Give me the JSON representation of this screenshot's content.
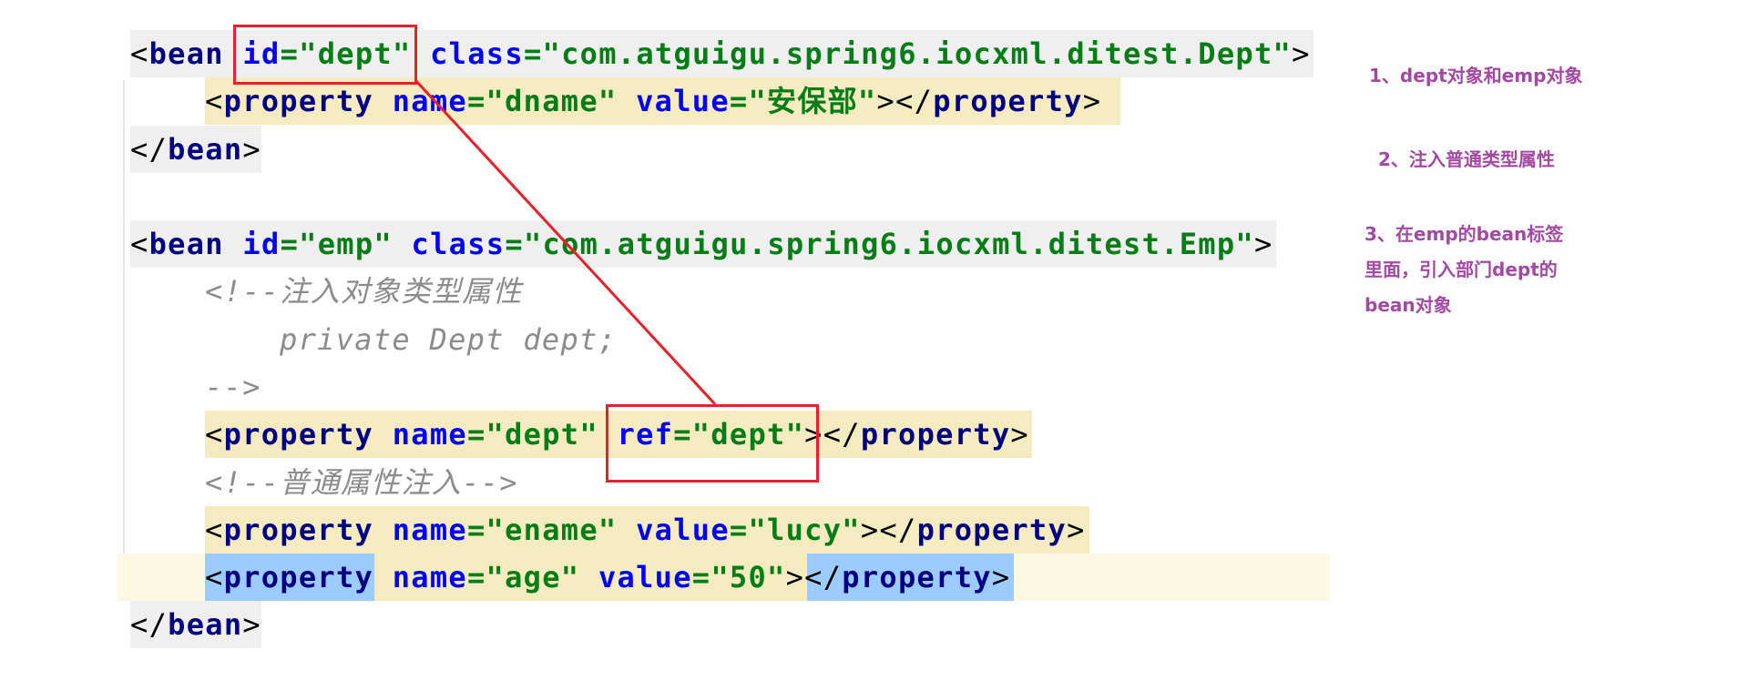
{
  "code": {
    "lines": [
      {
        "parts": [
          "<",
          "bean",
          " ",
          "id",
          "=\"dept\"",
          " ",
          "class",
          "=\"com.atguigu.spring6.iocxml.ditest.Dept\"",
          ">"
        ]
      },
      {
        "parts": [
          "<",
          "property",
          " ",
          "name",
          "=\"dname\"",
          " ",
          "value",
          "=\"安保部\"",
          "></",
          "property",
          ">"
        ]
      },
      {
        "parts": [
          "</",
          "bean",
          ">"
        ]
      },
      {
        "parts": [
          "<",
          "bean",
          " ",
          "id",
          "=\"emp\"",
          " ",
          "class",
          "=\"com.atguigu.spring6.iocxml.ditest.Emp\"",
          ">"
        ]
      },
      {
        "comment1": "<!--注入对象类型属性",
        "comment2": "private Dept dept;",
        "comment3": "-->"
      },
      {
        "parts": [
          "<",
          "property",
          " ",
          "name",
          "=\"dept\"",
          " ",
          "ref",
          "=\"dept\"",
          "></",
          "property",
          ">"
        ]
      },
      {
        "comment": "<!--普通属性注入-->"
      },
      {
        "parts": [
          "<",
          "property",
          " ",
          "name",
          "=\"ename\"",
          " ",
          "value",
          "=\"lucy\"",
          "></",
          "property",
          ">"
        ]
      },
      {
        "parts": [
          "<",
          "property",
          " ",
          "name",
          "=\"age\"",
          " ",
          "value",
          "=\"50\"",
          "></",
          "property",
          ">"
        ]
      },
      {
        "parts": [
          "</",
          "bean",
          ">"
        ]
      }
    ]
  },
  "notes": {
    "n1": "1、dept对象和emp对象",
    "n2": "2、注入普通类型属性",
    "n3a": "3、在emp的bean标签",
    "n3b": "里面，引入部门dept的",
    "n3c": "bean对象"
  },
  "colors": {
    "annotation": "#a349a4",
    "highlight_box": "#e8202a",
    "tag": "#000080",
    "attribute": "#0000ff",
    "value": "#067d17",
    "comment": "#8c8c8c"
  }
}
